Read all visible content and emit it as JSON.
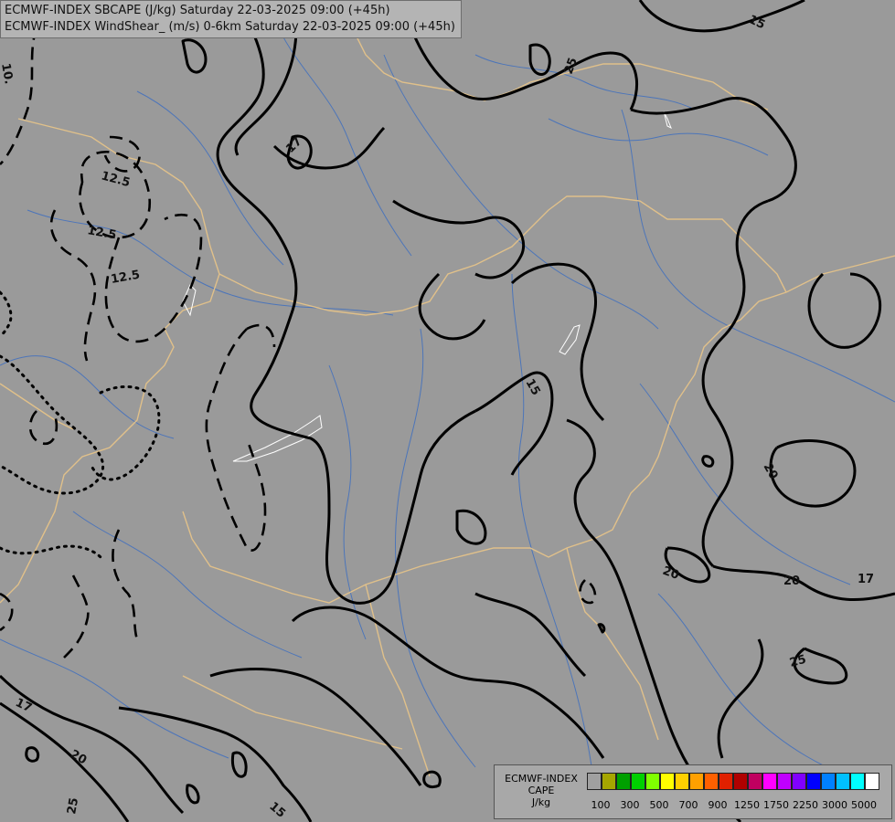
{
  "header": {
    "line1": "ECMWF-INDEX SBCAPE (J/kg) Saturday 22-03-2025 09:00 (+45h)",
    "line2": "ECMWF-INDEX WindShear_ (m/s) 0-6km Saturday 22-03-2025 09:00 (+45h)"
  },
  "legend": {
    "title": "ECMWF-INDEX",
    "variable": "CAPE",
    "unit": "J/kg",
    "colors": [
      "#a0a0a0",
      "#a6a600",
      "#00a000",
      "#00d000",
      "#80ff00",
      "#ffff00",
      "#ffd000",
      "#ffa000",
      "#ff6000",
      "#e02000",
      "#b00000",
      "#c00060",
      "#ff00ff",
      "#c000ff",
      "#8000ff",
      "#0000ff",
      "#0080ff",
      "#00c0ff",
      "#00ffff",
      "#ffffff"
    ],
    "tick_labels": [
      "100",
      "300",
      "500",
      "700",
      "900",
      "1250",
      "1750",
      "2250",
      "3000",
      "5000"
    ]
  },
  "contour_labels": [
    "15",
    "25",
    "17",
    "12.5",
    "12.5",
    "12.5",
    "15",
    "20",
    "20",
    "20",
    "17",
    "25",
    "17",
    "20",
    "25",
    "15",
    "10."
  ]
}
